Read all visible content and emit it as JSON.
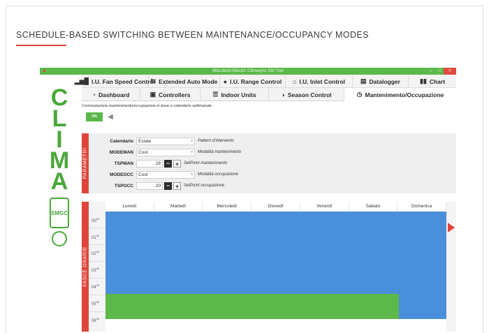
{
  "heading": "SCHEDULE-BASED SWITCHING BETWEEN MAINTENANCE/OCCUPANCY MODES",
  "window": {
    "title": "Mitsubishi Electric Climasync SW Tool",
    "controls": [
      "–",
      "□",
      "×"
    ]
  },
  "logo": {
    "letters": [
      "C",
      "L",
      "I",
      "M",
      "A"
    ],
    "badge": "SMGC"
  },
  "tabs_row1": [
    {
      "label": "I.U. Fan Speed Control",
      "icon": "bar-chart-icon",
      "glyph": "▂▅█"
    },
    {
      "label": "Extended Auto Mode",
      "icon": "arrows-icon",
      "glyph": "⇆"
    },
    {
      "label": "I.U. Range Control",
      "icon": "users-icon",
      "glyph": "👥"
    },
    {
      "label": "I.U. Inlet Control",
      "icon": "home-icon",
      "glyph": "⌂"
    },
    {
      "label": "Datalogger",
      "icon": "document-icon",
      "glyph": "▤"
    },
    {
      "label": "Chart",
      "icon": "chart-icon",
      "glyph": "▮▮"
    }
  ],
  "tabs_row2": [
    {
      "label": "Dashboard",
      "icon": "gauge-icon",
      "glyph": "◔",
      "active": false
    },
    {
      "label": "Controllers",
      "icon": "controller-icon",
      "glyph": "▣",
      "active": false
    },
    {
      "label": "Indoor Units",
      "icon": "list-icon",
      "glyph": "☰",
      "active": false
    },
    {
      "label": "Season Control",
      "icon": "half-circle-icon",
      "glyph": "◑",
      "active": false
    },
    {
      "label": "Mantenimento/Occupazione",
      "icon": "clock-icon",
      "glyph": "◷",
      "active": true
    }
  ],
  "subtitle": "Commutazione mantenimento/occupazione in base a calendario settimanale",
  "toggle": {
    "label": "ON"
  },
  "params_section": "PARAMETRI",
  "params": {
    "calendario": {
      "label": "Calendario",
      "value": "Estate",
      "hint": "Pattern d'intervento"
    },
    "modeman": {
      "label": "MODEMAN",
      "value": "Cool",
      "hint": "Modalità mantenimento"
    },
    "tspman": {
      "label": "TSPMAN",
      "value": "28",
      "hint": "SetPoint mantenimento"
    },
    "modeocc": {
      "label": "MODEOCC",
      "value": "Cool",
      "hint": "Modalità occupazione"
    },
    "tspocc": {
      "label": "TSPOCC",
      "value": "20",
      "hint": "SetPoint occupazione"
    }
  },
  "schedule_section": "FASCE ORARIE",
  "days": [
    "Lunedì",
    "Martedì",
    "Mercoledì",
    "Giovedì",
    "Venerdì",
    "Sabato",
    "Domenica"
  ],
  "hours": [
    "00",
    "01",
    "02",
    "03",
    "04",
    "05",
    "06"
  ],
  "hour_suffix": "00",
  "colors": {
    "maintenance": "#4a8fd9",
    "occupancy": "#5cb84a",
    "accent": "#e0453b"
  }
}
